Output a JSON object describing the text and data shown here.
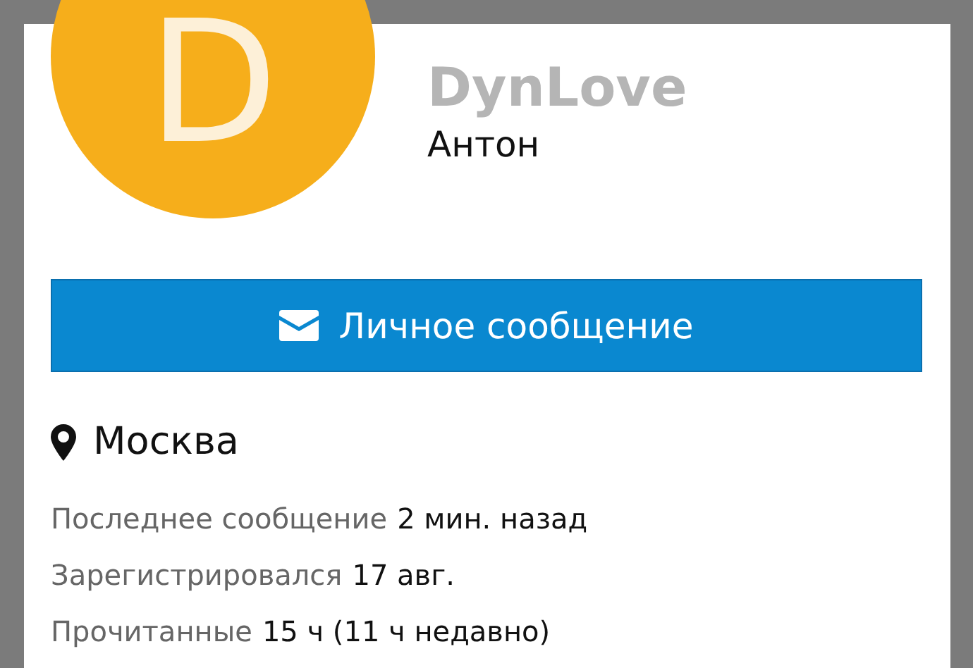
{
  "profile": {
    "avatar_letter": "D",
    "username": "DynLove",
    "name": "Антон"
  },
  "message_button": {
    "label": "Личное сообщение"
  },
  "location": "Москва",
  "stats": [
    {
      "label": "Последнее сообщение",
      "value": "2 мин. назад"
    },
    {
      "label": "Зарегистрировался",
      "value": "17 авг."
    },
    {
      "label": "Прочитанные",
      "value": "15 ч (11 ч недавно)"
    }
  ]
}
